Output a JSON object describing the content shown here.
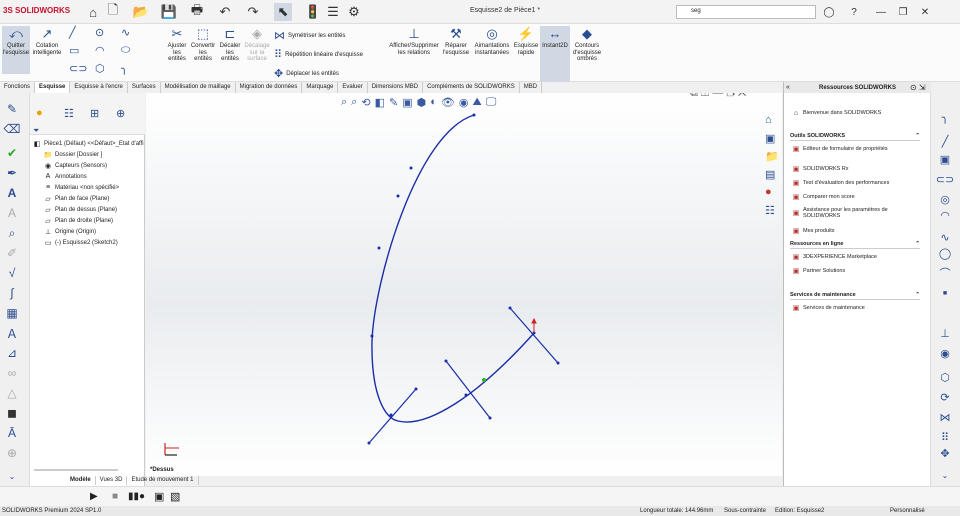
{
  "app": {
    "logo": "SOLIDWORKS",
    "doc_title": "Esquisse2 de Pièce1 *",
    "search_value": "seg"
  },
  "command_manager": {
    "buttons": [
      {
        "label": "Quitter l'esquisse",
        "icon": "exit-sketch-icon"
      },
      {
        "label": "Cotation intelligente",
        "icon": "smart-dimension-icon"
      },
      {
        "label": "Ajuster les entités",
        "icon": "trim-icon"
      },
      {
        "label": "Convertir les entités",
        "icon": "convert-icon"
      },
      {
        "label": "Décaler les entités",
        "icon": "offset-icon"
      },
      {
        "label": "Décalage sur la surface",
        "icon": "offset-surface-icon"
      },
      {
        "label": "Afficher/Supprimer les relations",
        "icon": "relations-icon"
      },
      {
        "label": "Réparer l'esquisse",
        "icon": "repair-icon"
      },
      {
        "label": "Aimantations instantanées",
        "icon": "snap-icon"
      },
      {
        "label": "Esquisse rapide",
        "icon": "rapid-sketch-icon"
      },
      {
        "label": "Instant2D",
        "icon": "instant2d-icon"
      },
      {
        "label": "Contours d'esquisse ombrés",
        "icon": "shaded-contours-icon"
      }
    ],
    "mirror_label": "Symétriser les entités",
    "linear_pattern_label": "Répétition linéaire d'esquisse",
    "move_label": "Déplacer les entités"
  },
  "tabs": [
    "Fonctions",
    "Esquisse",
    "Esquisse à l'encre",
    "Surfaces",
    "Modélisation de maillage",
    "Migration de données",
    "Marquage",
    "Evaluer",
    "Dimensions MBD",
    "Compléments de SOLIDWORKS",
    "MBD"
  ],
  "active_tab": "Esquisse",
  "tree": {
    "root": "Pièce1 (Défaut) <<Défaut>_Etat d'affi",
    "items": [
      {
        "label": "Dossier [Dossier ]",
        "icon": "folder-icon"
      },
      {
        "label": "Capteurs (Sensors)",
        "icon": "sensor-icon"
      },
      {
        "label": "Annotations",
        "icon": "annotation-icon"
      },
      {
        "label": "Matériau <non spécifié>",
        "icon": "material-icon"
      },
      {
        "label": "Plan de face (Plane)",
        "icon": "plane-icon"
      },
      {
        "label": "Plan de dessus (Plane)",
        "icon": "plane-icon"
      },
      {
        "label": "Plan de droite (Plane)",
        "icon": "plane-icon"
      },
      {
        "label": "Origine (Origin)",
        "icon": "origin-icon"
      },
      {
        "label": "(-) Esquisse2 (Sketch2)",
        "icon": "sketch-icon"
      }
    ]
  },
  "viewport": {
    "view_label": "*Dessus"
  },
  "task_pane": {
    "title": "Ressources SOLIDWORKS",
    "welcome": "Bienvenue dans SOLIDWORKS",
    "sections": [
      {
        "title": "Outils SOLIDWORKS",
        "items": [
          "Editeur de formulaire de propriétés",
          "SOLIDWORKS Rx",
          "Test d'évaluation des performances",
          "Comparer mon score",
          "Assistance pour les paramètres de SOLIDWORKS",
          "Mes produits"
        ]
      },
      {
        "title": "Ressources en ligne",
        "items": [
          "3DEXPERIENCE Marketplace",
          "Partner Solutions"
        ]
      },
      {
        "title": "Services de maintenance",
        "items": [
          "Services de maintenance"
        ]
      }
    ]
  },
  "bottom_tabs": [
    "Modèle",
    "Vues 3D",
    "Etude de mouvement 1"
  ],
  "active_bottom_tab": "Modèle",
  "status": {
    "product": "SOLIDWORKS Premium 2024 SP1.0",
    "length": "Longueur totale: 144.96mm",
    "constraint": "Sous-contrainte",
    "edition": "Edition: Esquisse2",
    "units": "Personnalisé"
  },
  "colors": {
    "sketch_line": "#1a2ea8",
    "accent": "#2a4d8f",
    "origin_red": "#d02020"
  }
}
